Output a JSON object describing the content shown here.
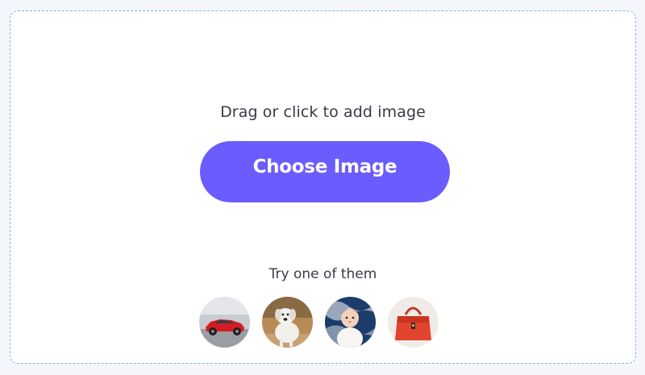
{
  "dropzone": {
    "prompt": "Drag or click to add image",
    "choose_button_label": "Choose Image",
    "try_label": "Try one of them"
  },
  "samples": [
    {
      "icon": "sample-car-image"
    },
    {
      "icon": "sample-dog-image"
    },
    {
      "icon": "sample-baby-image"
    },
    {
      "icon": "sample-handbag-image"
    }
  ],
  "colors": {
    "accent": "#6b5cfe",
    "border": "#7fb3e6",
    "page_bg": "#f5f6fc",
    "text": "#3a3a44"
  }
}
